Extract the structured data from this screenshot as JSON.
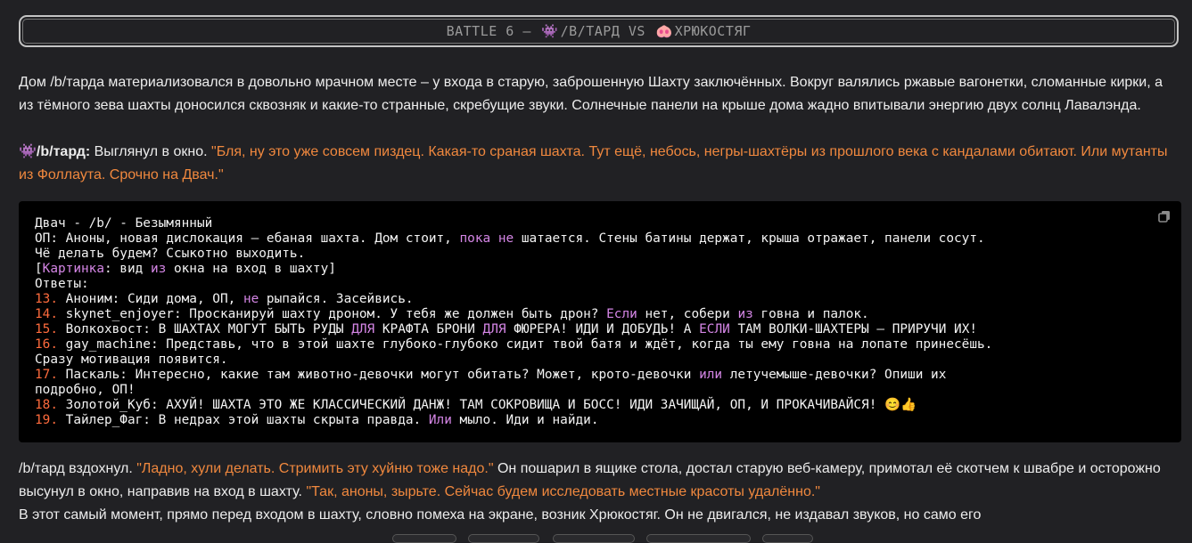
{
  "header": {
    "prefix": "BATTLE 6 –",
    "left_name": "/B/ТАРД",
    "vs": "VS",
    "right_name": "ХРЮКОСТЯГ",
    "left_emoji": "👾",
    "right_emoji": "🐽"
  },
  "intro": {
    "text": "Дом /b/тарда материализовался в довольно мрачном месте – у входа в старую, заброшенную Шахту заключённых. Вокруг валялись ржавые вагонетки, сломанные кирки, а из тёмного зева шахты доносился сквозняк и какие-то странные, скребущие звуки. Солнечные панели на крыше дома жадно впитывали энергию двух солнц Лавалэнда."
  },
  "line2": {
    "emoji": "👾",
    "speaker": "/b/тард:",
    "action": " Выглянул в окно. ",
    "quote": "\"Бля, ну это уже совсем пиздец. Какая-то сраная шахта. Тут ещё, небось, негры-шахтёры из прошлого века с кандалами обитают. Или мутанты из Фоллаута. Срочно на Двач.\""
  },
  "code": {
    "title": "Двач - /b/ - Безымянный",
    "op_a": "ОП: Аноны, новая дислокация – ебаная шахта. Дом стоит, ",
    "op_kw1": "пока",
    "op_kw2": "не",
    "op_b": " шатается. Стены батины держат, крыша отражает, панели сосут.",
    "op_c": "Чё делать будем? Ссыкотно выходить.",
    "pic_open": "[",
    "pic_kw": "Картинка",
    "pic_a": ": вид ",
    "pic_kw2": "из",
    "pic_b": " окна на вход в шахту]",
    "answers": "Ответы:",
    "r13_num": "13.",
    "r13_a": " Аноним: Сиди дома, ОП, ",
    "r13_kw": "не",
    "r13_b": " рыпайся. Засейвись.",
    "r14_num": "14.",
    "r14_a": " skynet_enjoyer: Просканируй шахту дроном. У тебя же должен быть дрон? ",
    "r14_kw": "Если",
    "r14_b": " нет, собери ",
    "r14_kw2": "из",
    "r14_c": " говна и палок.",
    "r15_num": "15.",
    "r15_a": " Волкохвост: В ШАХТАХ МОГУТ БЫТЬ РУДЫ ",
    "r15_kw": "ДЛЯ",
    "r15_b": " КРАФТА БРОНИ ",
    "r15_kw2": "ДЛЯ",
    "r15_c": " ФЮРЕРА! ИДИ И ДОБУДЬ! А ",
    "r15_kw3": "ЕСЛИ",
    "r15_d": " ТАМ ВОЛКИ-ШАХТЕРЫ – ПРИРУЧИ ИХ!",
    "r16_num": "16.",
    "r16_a": " gay_machine: Представь, что в этой шахте глубоко-глубоко сидит твой батя и ждёт, когда ты ему говна на лопате принесёшь.",
    "r16_b": "Сразу мотивация появится.",
    "r17_num": "17.",
    "r17_a": " Паскаль: Интересно, какие там животно-девочки могут обитать? Может, крото-девочки ",
    "r17_kw": "или",
    "r17_b": " летучемыше-девочки? Опиши их",
    "r17_c": "подробно, ОП!",
    "r18_num": "18.",
    "r18_a": " Золотой_Куб: АХУЙ! ШАХТА ЭТО ЖЕ КЛАССИЧЕСКИЙ ДАНЖ! ТАМ СОКРОВИЩА И БОСС! ИДИ ЗАЧИЩАЙ, ОП, И ПРОКАЧИВАЙСЯ! ",
    "r18_emoji": "😊👍",
    "r19_num": "19.",
    "r19_a": " Тайлер_Фаг: В недрах этой шахты скрыта правда. ",
    "r19_kw": "Или",
    "r19_b": " мыло. Иди и найди."
  },
  "outro": {
    "a": "/b/тард вздохнул. ",
    "q1": "\"Ладно, хули делать. Стримить эту хуйню тоже надо.\"",
    "b": " Он пошарил в ящике стола, достал старую веб-камеру, примотал её скотчем к швабре и осторожно высунул в окно, направив на вход в шахту. ",
    "q2": "\"Так, аноны, зырьте. Сейчас будем исследовать местные красоты удалённо.\""
  },
  "last": {
    "text": "В этот самый момент, прямо перед входом в шахту, словно помеха на экране, возник Хрюкостяг. Он не двигался, не издавал звуков, но само его"
  },
  "icons": {
    "copy": "copy-icon"
  },
  "colors": {
    "background": "#212124",
    "quote": "#f0883e",
    "keyword": "#d586e6",
    "number": "#ff6b3d"
  }
}
